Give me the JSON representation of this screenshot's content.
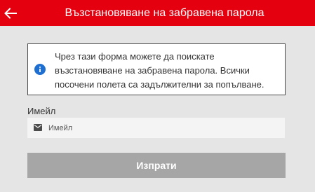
{
  "header": {
    "title": "Възстановяване на забравена парола",
    "back_icon": "arrow-left-icon"
  },
  "info": {
    "icon": "info-icon",
    "text": "Чрез тази форма можете да поискате възстановяване на забравена парола. Всички посочени полета са задължителни за попълване."
  },
  "form": {
    "email_label": "Имейл",
    "email_placeholder": "Имейл",
    "email_value": "",
    "email_icon": "mail-icon",
    "submit_label": "Изпрати"
  },
  "colors": {
    "header_bg": "#e4000f",
    "page_bg": "#e5e5e5",
    "info_icon": "#1f6fd1",
    "button_bg": "#a6a6a6"
  }
}
